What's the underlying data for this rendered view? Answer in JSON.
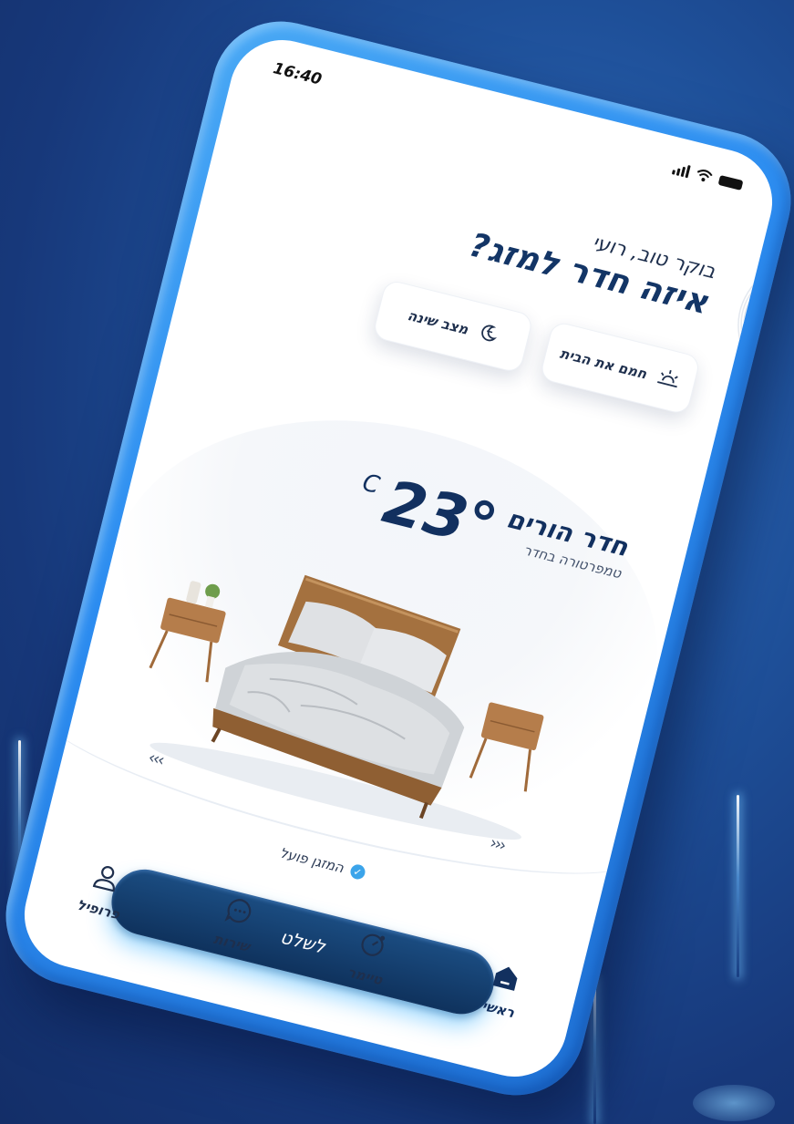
{
  "status_bar": {
    "time": "16:40"
  },
  "greeting": {
    "hello": "בוקר טוב, רועי",
    "question": "איזה חדר למזג?"
  },
  "quick_actions": [
    {
      "label": "חמם את הבית",
      "icon": "sunrise-icon"
    },
    {
      "label": "מצב שינה",
      "icon": "moon-sleep-icon"
    }
  ],
  "room": {
    "temperature": "23°",
    "unit": "C",
    "name": "חדר הורים",
    "subtitle": "טמפרטורה בחדר"
  },
  "carousel": {
    "prev_arrows": "‹‹‹",
    "next_arrows": "›››"
  },
  "ac_status": {
    "text": "המזגן פועל"
  },
  "control_button": {
    "label": "לשלט"
  },
  "tabs": [
    {
      "label": "פרופיל",
      "icon": "user-icon"
    },
    {
      "label": "שירות",
      "icon": "chat-icon"
    },
    {
      "label": "טיימר",
      "icon": "timer-icon"
    },
    {
      "label": "ראשי",
      "icon": "home-icon",
      "active": true
    }
  ],
  "colors": {
    "primary": "#12305f",
    "accent": "#3ba4ea",
    "phone_frame": "#2c8cf0",
    "background": "#1e4f98"
  }
}
